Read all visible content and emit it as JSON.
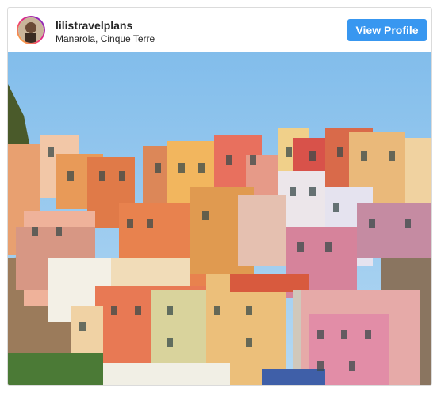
{
  "post": {
    "username": "lilistravelplans",
    "location": "Manarola, Cinque Terre",
    "view_profile_label": "View Profile"
  },
  "icons": {
    "avatar": "profile-avatar",
    "photo": "cinque-terre-village-photo"
  },
  "colors": {
    "button": "#3897f0",
    "sky": "#8fc5ef",
    "ring_start": "#f9ce34",
    "ring_end": "#6228d7"
  }
}
